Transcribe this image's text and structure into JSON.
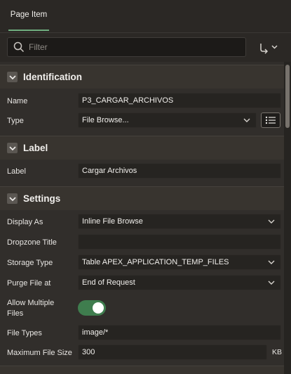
{
  "tabs": [
    {
      "label": "Page Item"
    }
  ],
  "search": {
    "placeholder": "Filter"
  },
  "toolbar": {
    "goto_icon": "goto-group-icon"
  },
  "sections": {
    "identification": {
      "title": "Identification",
      "name_label": "Name",
      "name_value": "P3_CARGAR_ARCHIVOS",
      "type_label": "Type",
      "type_value": "File Browse..."
    },
    "label": {
      "title": "Label",
      "label_label": "Label",
      "label_value": "Cargar Archivos"
    },
    "settings": {
      "title": "Settings",
      "display_as_label": "Display As",
      "display_as_value": "Inline File Browse",
      "dropzone_title_label": "Dropzone Title",
      "dropzone_title_value": "",
      "storage_type_label": "Storage Type",
      "storage_type_value": "Table APEX_APPLICATION_TEMP_FILES",
      "purge_label": "Purge File at",
      "purge_value": "End of Request",
      "allow_multiple_label_1": "Allow Multiple",
      "allow_multiple_label_2": "Files",
      "allow_multiple_on": true,
      "file_types_label": "File Types",
      "file_types_value": "image/*",
      "max_size_label": "Maximum File Size",
      "max_size_value": "300",
      "max_size_unit": "KB"
    }
  },
  "colors": {
    "accent": "#6fae7f",
    "toggle_on": "#3f7d4e",
    "background": "#322f2c",
    "field": "#262421"
  }
}
